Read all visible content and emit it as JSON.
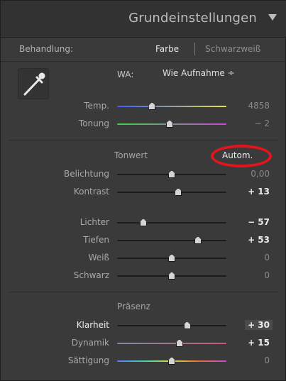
{
  "header": {
    "title": "Grundeinstellungen"
  },
  "treatment": {
    "label": "Behandlung:",
    "color": "Farbe",
    "bw": "Schwarzweiß"
  },
  "wb": {
    "label": "WA:",
    "value": "Wie Aufnahme ÷"
  },
  "sliders": {
    "temp": {
      "label": "Temp.",
      "value": "4858",
      "level": 0.32
    },
    "tint": {
      "label": "Tonung",
      "value": "− 2",
      "level": 0.48
    },
    "exposure": {
      "label": "Belichtung",
      "value": "0,00",
      "level": 0.5
    },
    "contrast": {
      "label": "Kontrast",
      "value": "+ 13",
      "level": 0.56
    },
    "highlights": {
      "label": "Lichter",
      "value": "− 57",
      "level": 0.24
    },
    "shadows": {
      "label": "Tiefen",
      "value": "+ 53",
      "level": 0.74
    },
    "whites": {
      "label": "Weiß",
      "value": "0",
      "level": 0.5
    },
    "blacks": {
      "label": "Schwarz",
      "value": "0",
      "level": 0.5
    },
    "clarity": {
      "label": "Klarheit",
      "value": "+ 30",
      "level": 0.64
    },
    "vibrance": {
      "label": "Dynamik",
      "value": "+ 15",
      "level": 0.57
    },
    "saturation": {
      "label": "Sättigung",
      "value": "0",
      "level": 0.5
    }
  },
  "tone": {
    "title": "Tonwert",
    "auto": "Autom."
  },
  "presence": {
    "title": "Präsenz"
  },
  "colors": {
    "panel": "#3a3a3a",
    "header": "#323232",
    "highlight_ring": "#e2141d"
  }
}
